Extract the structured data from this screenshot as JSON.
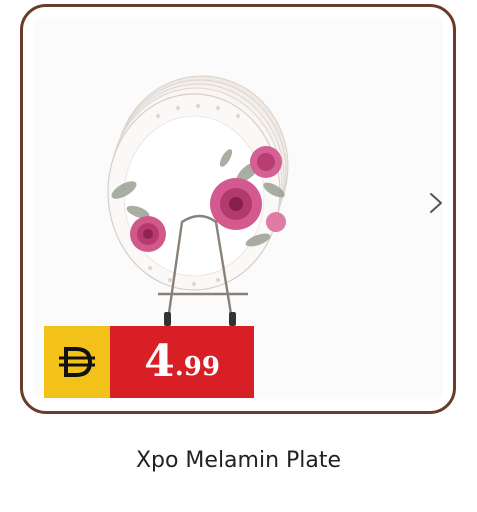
{
  "product": {
    "name": "Xpo Melamin Plate",
    "image_icon": "plate-set-image",
    "price": {
      "currency_icon": "dirham-icon",
      "integer": "4",
      "decimal": ".99"
    }
  },
  "navigation": {
    "next_icon": "chevron-right-icon"
  },
  "colors": {
    "card_border": "#6b3b2a",
    "currency_bg": "#f2c21a",
    "price_bg": "#d91f26"
  }
}
